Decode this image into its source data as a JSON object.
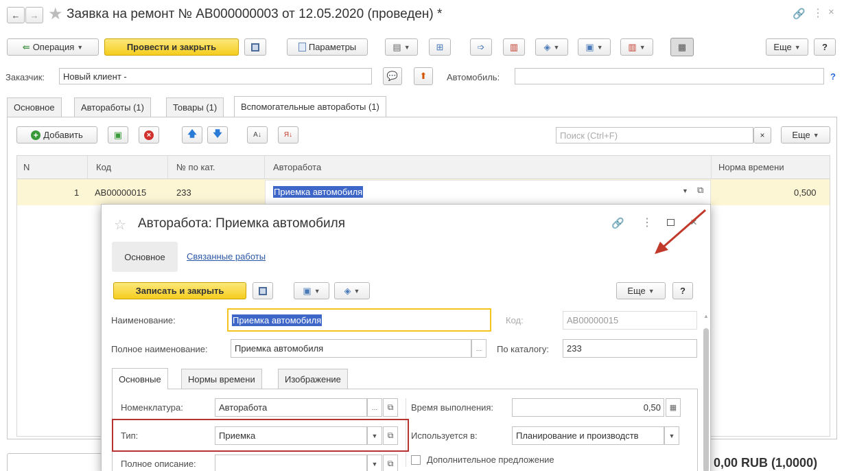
{
  "doc": {
    "title": "Заявка на ремонт № АВ000000003 от 12.05.2020 (проведен) *",
    "toolbar": {
      "operation": "Операция",
      "post_close": "Провести и закрыть",
      "params": "Параметры",
      "more": "Еще",
      "help": "?"
    },
    "customer_label": "Заказчик:",
    "customer_value": "Новый клиент -",
    "car_label": "Автомобиль:",
    "car_value": "",
    "help_mark": "?",
    "tabs": [
      "Основное",
      "Автоработы (1)",
      "Товары (1)",
      "Вспомогательные автоработы (1)"
    ],
    "table_toolbar": {
      "add": "Добавить",
      "search_placeholder": "Поиск (Ctrl+F)",
      "clear": "×",
      "more": "Еще"
    },
    "table": {
      "headers": [
        "N",
        "Код",
        "№ по кат.",
        "Авторабота",
        "Норма времени"
      ],
      "rows": [
        {
          "n": "1",
          "code": "АВ00000015",
          "cat": "233",
          "work": "Приемка автомобиля",
          "norm": "0,500"
        }
      ]
    },
    "footer_partial": "0,00 RUB (1,0000)"
  },
  "dialog": {
    "title": "Авторабота: Приемка автомобиля",
    "nav": [
      "Основное",
      "Связанные работы"
    ],
    "toolbar": {
      "save_close": "Записать и закрыть",
      "more": "Еще",
      "help": "?"
    },
    "name_label": "Наименование:",
    "name_value": "Приемка автомобиля",
    "code_label": "Код:",
    "code_value": "АВ00000015",
    "fullname_label": "Полное наименование:",
    "fullname_value": "Приемка автомобиля",
    "catalog_label": "По каталогу:",
    "catalog_value": "233",
    "tabs": [
      "Основные",
      "Нормы времени",
      "Изображение"
    ],
    "nomen_label": "Номенклатура:",
    "nomen_value": "Авторабота",
    "exec_label": "Время выполнения:",
    "exec_value": "0,50",
    "type_label": "Тип:",
    "type_value": "Приемка",
    "used_label": "Используется в:",
    "used_value": "Планирование и производств",
    "desc_label": "Полное описание:",
    "desc_value": "",
    "extra_label": "Дополнительное предложение"
  },
  "colors": {
    "accent_yellow": "#f5cd1e",
    "selected_row": "#fdf6d5",
    "highlight": "#3d66c8",
    "annotation_red": "#c0392b"
  }
}
